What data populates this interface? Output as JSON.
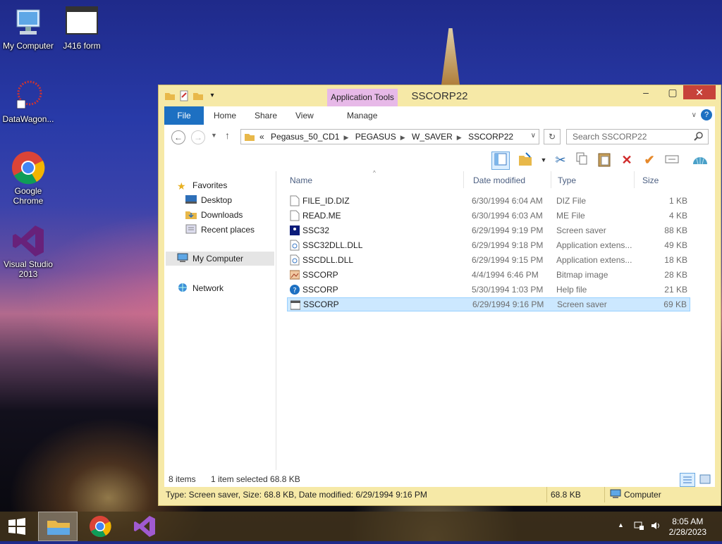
{
  "desktop": {
    "icons": [
      {
        "label": "My Computer"
      },
      {
        "label": "J416 form"
      },
      {
        "label": "DataWagon..."
      },
      {
        "label": "Google Chrome"
      },
      {
        "label": "Visual Studio 2013"
      }
    ]
  },
  "window": {
    "title": "SSCORP22",
    "context_tab": "Application Tools",
    "ribbon_tabs": [
      "File",
      "Home",
      "Share",
      "View",
      "Manage"
    ],
    "address": {
      "prefix": "«",
      "crumbs": [
        "Pegasus_50_CD1",
        "PEGASUS",
        "W_SAVER",
        "SSCORP22"
      ]
    },
    "search_placeholder": "Search SSCORP22",
    "nav": {
      "favorites": "Favorites",
      "favorites_items": [
        "Desktop",
        "Downloads",
        "Recent places"
      ],
      "computer": "My Computer",
      "network": "Network"
    },
    "columns": {
      "name": "Name",
      "date": "Date modified",
      "type": "Type",
      "size": "Size"
    },
    "files": [
      {
        "name": "FILE_ID.DIZ",
        "date": "6/30/1994 6:04 AM",
        "type": "DIZ File",
        "size": "1 KB",
        "icon": "document-icon"
      },
      {
        "name": "READ.ME",
        "date": "6/30/1994 6:03 AM",
        "type": "ME File",
        "size": "4 KB",
        "icon": "document-icon"
      },
      {
        "name": "SSC32",
        "date": "6/29/1994 9:19 PM",
        "type": "Screen saver",
        "size": "88 KB",
        "icon": "screensaver-icon"
      },
      {
        "name": "SSC32DLL.DLL",
        "date": "6/29/1994 9:18 PM",
        "type": "Application extens...",
        "size": "49 KB",
        "icon": "dll-icon"
      },
      {
        "name": "SSCDLL.DLL",
        "date": "6/29/1994 9:15 PM",
        "type": "Application extens...",
        "size": "18 KB",
        "icon": "dll-icon"
      },
      {
        "name": "SSCORP",
        "date": "4/4/1994 6:46 PM",
        "type": "Bitmap image",
        "size": "28 KB",
        "icon": "bitmap-icon"
      },
      {
        "name": "SSCORP",
        "date": "5/30/1994 1:03 PM",
        "type": "Help file",
        "size": "21 KB",
        "icon": "help-icon"
      },
      {
        "name": "SSCORP",
        "date": "6/29/1994 9:16 PM",
        "type": "Screen saver",
        "size": "69 KB",
        "icon": "screensaver-window-icon",
        "selected": true
      }
    ],
    "status": {
      "count": "8 items",
      "selection": "1 item selected  68.8 KB"
    },
    "details_bar": {
      "info": "Type: Screen saver, Size: 68.8 KB, Date modified: 6/29/1994 9:16 PM",
      "size": "68.8 KB",
      "location": "Computer"
    }
  },
  "taskbar": {
    "time": "8:05 AM",
    "date": "2/28/2023"
  }
}
